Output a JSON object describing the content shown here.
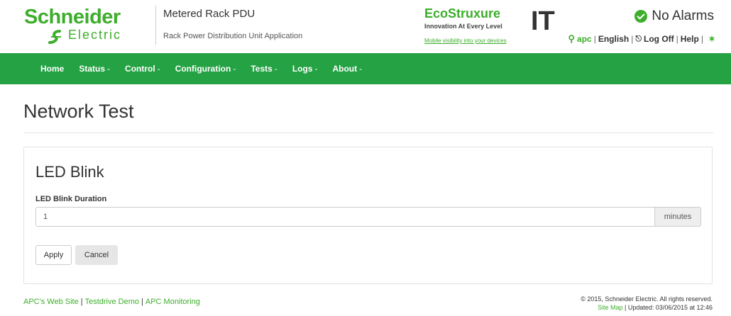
{
  "header": {
    "brand_line1": "Schneider",
    "brand_line2": "Electric",
    "app_title": "Metered Rack PDU",
    "app_subtitle": "Rack Power Distribution Unit Application",
    "eco": {
      "word": "EcoStruxure",
      "tagline": "Innovation At Every Level",
      "link": "Mobile visibility into your devices",
      "it": "IT"
    },
    "alarm_status": "No Alarms",
    "user": {
      "name": "apc",
      "language": "English",
      "logoff": "Log Off",
      "help": "Help"
    }
  },
  "nav": {
    "items": [
      {
        "label": "Home",
        "caret": ""
      },
      {
        "label": "Status",
        "caret": "-"
      },
      {
        "label": "Control",
        "caret": "-"
      },
      {
        "label": "Configuration",
        "caret": "-"
      },
      {
        "label": "Tests",
        "caret": "-"
      },
      {
        "label": "Logs",
        "caret": "-"
      },
      {
        "label": "About",
        "caret": "-"
      }
    ]
  },
  "page": {
    "title": "Network Test"
  },
  "panel": {
    "heading": "LED Blink",
    "field_label": "LED Blink Duration",
    "field_value": "1",
    "field_unit": "minutes",
    "apply_label": "Apply",
    "cancel_label": "Cancel"
  },
  "footer": {
    "links": [
      "APC's Web Site",
      "Testdrive Demo",
      "APC Monitoring"
    ],
    "copyright": "© 2015, Schneider Electric. All rights reserved.",
    "site_map": "Site Map",
    "updated": "Updated: 03/06/2015 at 12:46"
  },
  "colors": {
    "brand_green": "#3dae2b",
    "nav_green": "#25a244"
  }
}
